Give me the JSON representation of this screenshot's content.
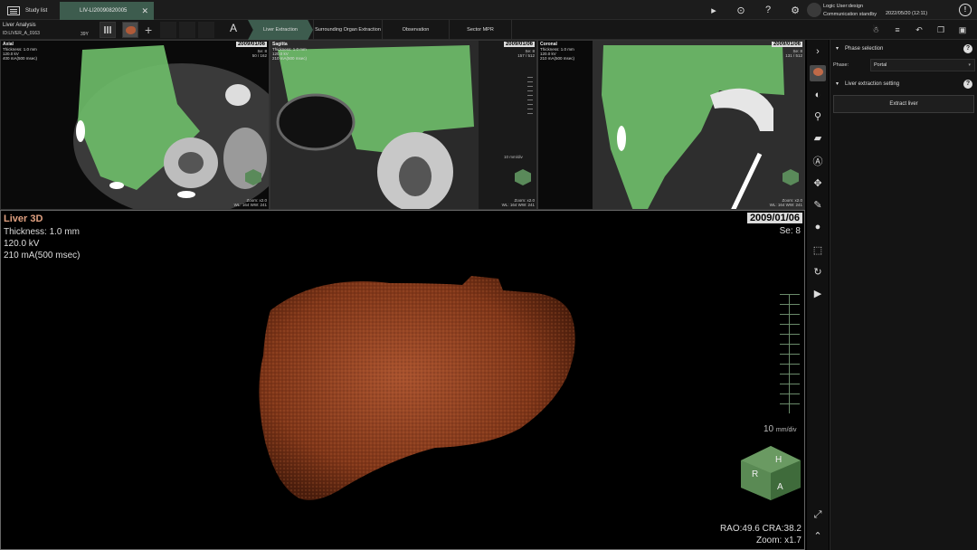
{
  "tabs": {
    "study_list": "Study list",
    "patient": "LIV-LI20090820005"
  },
  "user": {
    "name": "Logic User:design",
    "status": "Communication standby",
    "datetime": "2022/05/20 (12:11)"
  },
  "app": {
    "name": "Liver Analysis",
    "id": "ID:LIVER_A_0163",
    "age": "39Y"
  },
  "steps": [
    {
      "label": "Liver Extraction"
    },
    {
      "label": "Surrounding Organ Extraction"
    },
    {
      "label": "Observation"
    },
    {
      "label": "Sector MPR"
    }
  ],
  "views": {
    "axial": {
      "title": "Axial",
      "info": [
        "Thickness: 1.0 mm",
        "120.0 kV",
        "400 mA(500 msec)"
      ],
      "date": "2009/01/06",
      "se": [
        "Se: 8",
        "50 / 162"
      ],
      "zoom": [
        "Zoom: x2.0",
        "WL: 164  WW: 241"
      ]
    },
    "sagittal": {
      "title": "Sagitta",
      "info": [
        "Thickness: 1.0 mm",
        "120.0 kV",
        "210 mA(500 msec)"
      ],
      "date": "2009/01/06",
      "se": [
        "Se: 8",
        "157 / 512"
      ],
      "zoom": [
        "Zoom: x2.0",
        "WL: 164  WW: 241"
      ],
      "mm": "10 mm/div"
    },
    "coronal": {
      "title": "Coronal",
      "info": [
        "Thickness: 1.0 mm",
        "120.0 kV",
        "210 mA(500 msec)"
      ],
      "date": "2009/01/06",
      "se": [
        "Se: 8",
        "131 / 512"
      ],
      "zoom": [
        "Zoom: x2.0",
        "WL: 164  WW: 241"
      ]
    }
  },
  "liver3d": {
    "title": "Liver 3D",
    "thickness": "Thickness: 1.0 mm",
    "kv": "120.0 kV",
    "ma": "210 mA(500 msec)",
    "date": "2009/01/06",
    "se": "Se: 8",
    "scale": "10",
    "scale_unit": "mm/div",
    "cube": {
      "top": "H",
      "left": "R",
      "right": "A"
    },
    "angle": "RAO:49.6 CRA:38.2",
    "zoom": "Zoom: x1.7"
  },
  "panel": {
    "phase_selection": "Phase selection",
    "phase_label": "Phase:",
    "phase_value": "Portal",
    "extraction_setting": "Liver extraction setting",
    "extract_btn": "Extract liver"
  },
  "colors": {
    "accent": "#3d5c4e",
    "liver_overlay": "#6fbf6a",
    "liver_3d": "#8b3a1e"
  }
}
